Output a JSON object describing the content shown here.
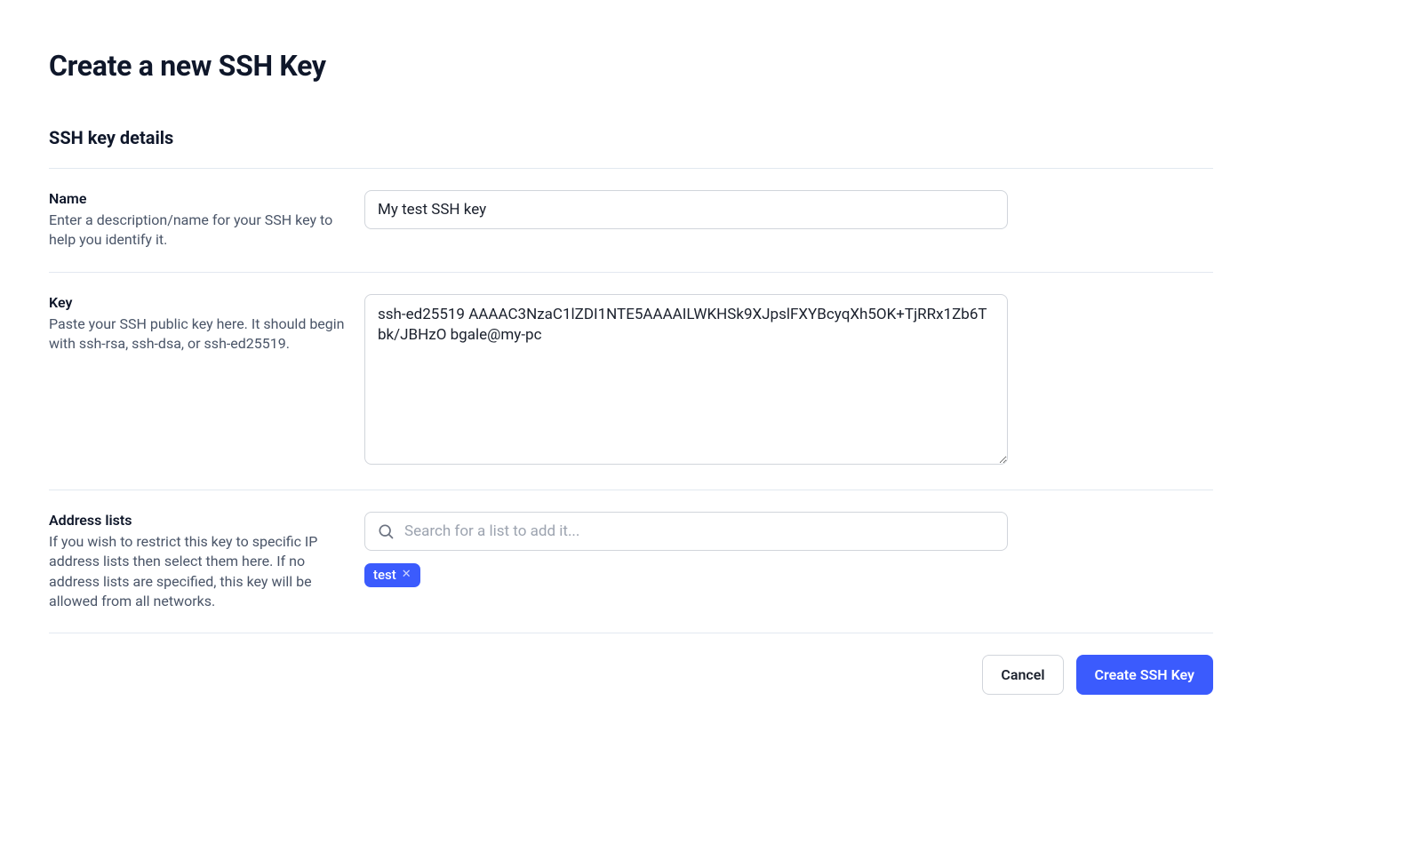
{
  "page": {
    "title": "Create a new SSH Key",
    "section_title": "SSH key details"
  },
  "fields": {
    "name": {
      "label": "Name",
      "desc": "Enter a description/name for your SSH key to help you identify it.",
      "value": "My test SSH key"
    },
    "key": {
      "label": "Key",
      "desc": "Paste your SSH public key here. It should begin with ssh-rsa, ssh-dsa, or ssh-ed25519.",
      "value": "ssh-ed25519 AAAAC3NzaC1lZDI1NTE5AAAAILWKHSk9XJpslFXYBcyqXh5OK+TjRRx1Zb6Tbk/JBHzO bgale@my-pc"
    },
    "address_lists": {
      "label": "Address lists",
      "desc": "If you wish to restrict this key to specific IP address lists then select them here. If no address lists are specified, this key will be allowed from all networks.",
      "placeholder": "Search for a list to add it...",
      "tags": [
        "test"
      ]
    }
  },
  "actions": {
    "cancel": "Cancel",
    "submit": "Create SSH Key"
  }
}
